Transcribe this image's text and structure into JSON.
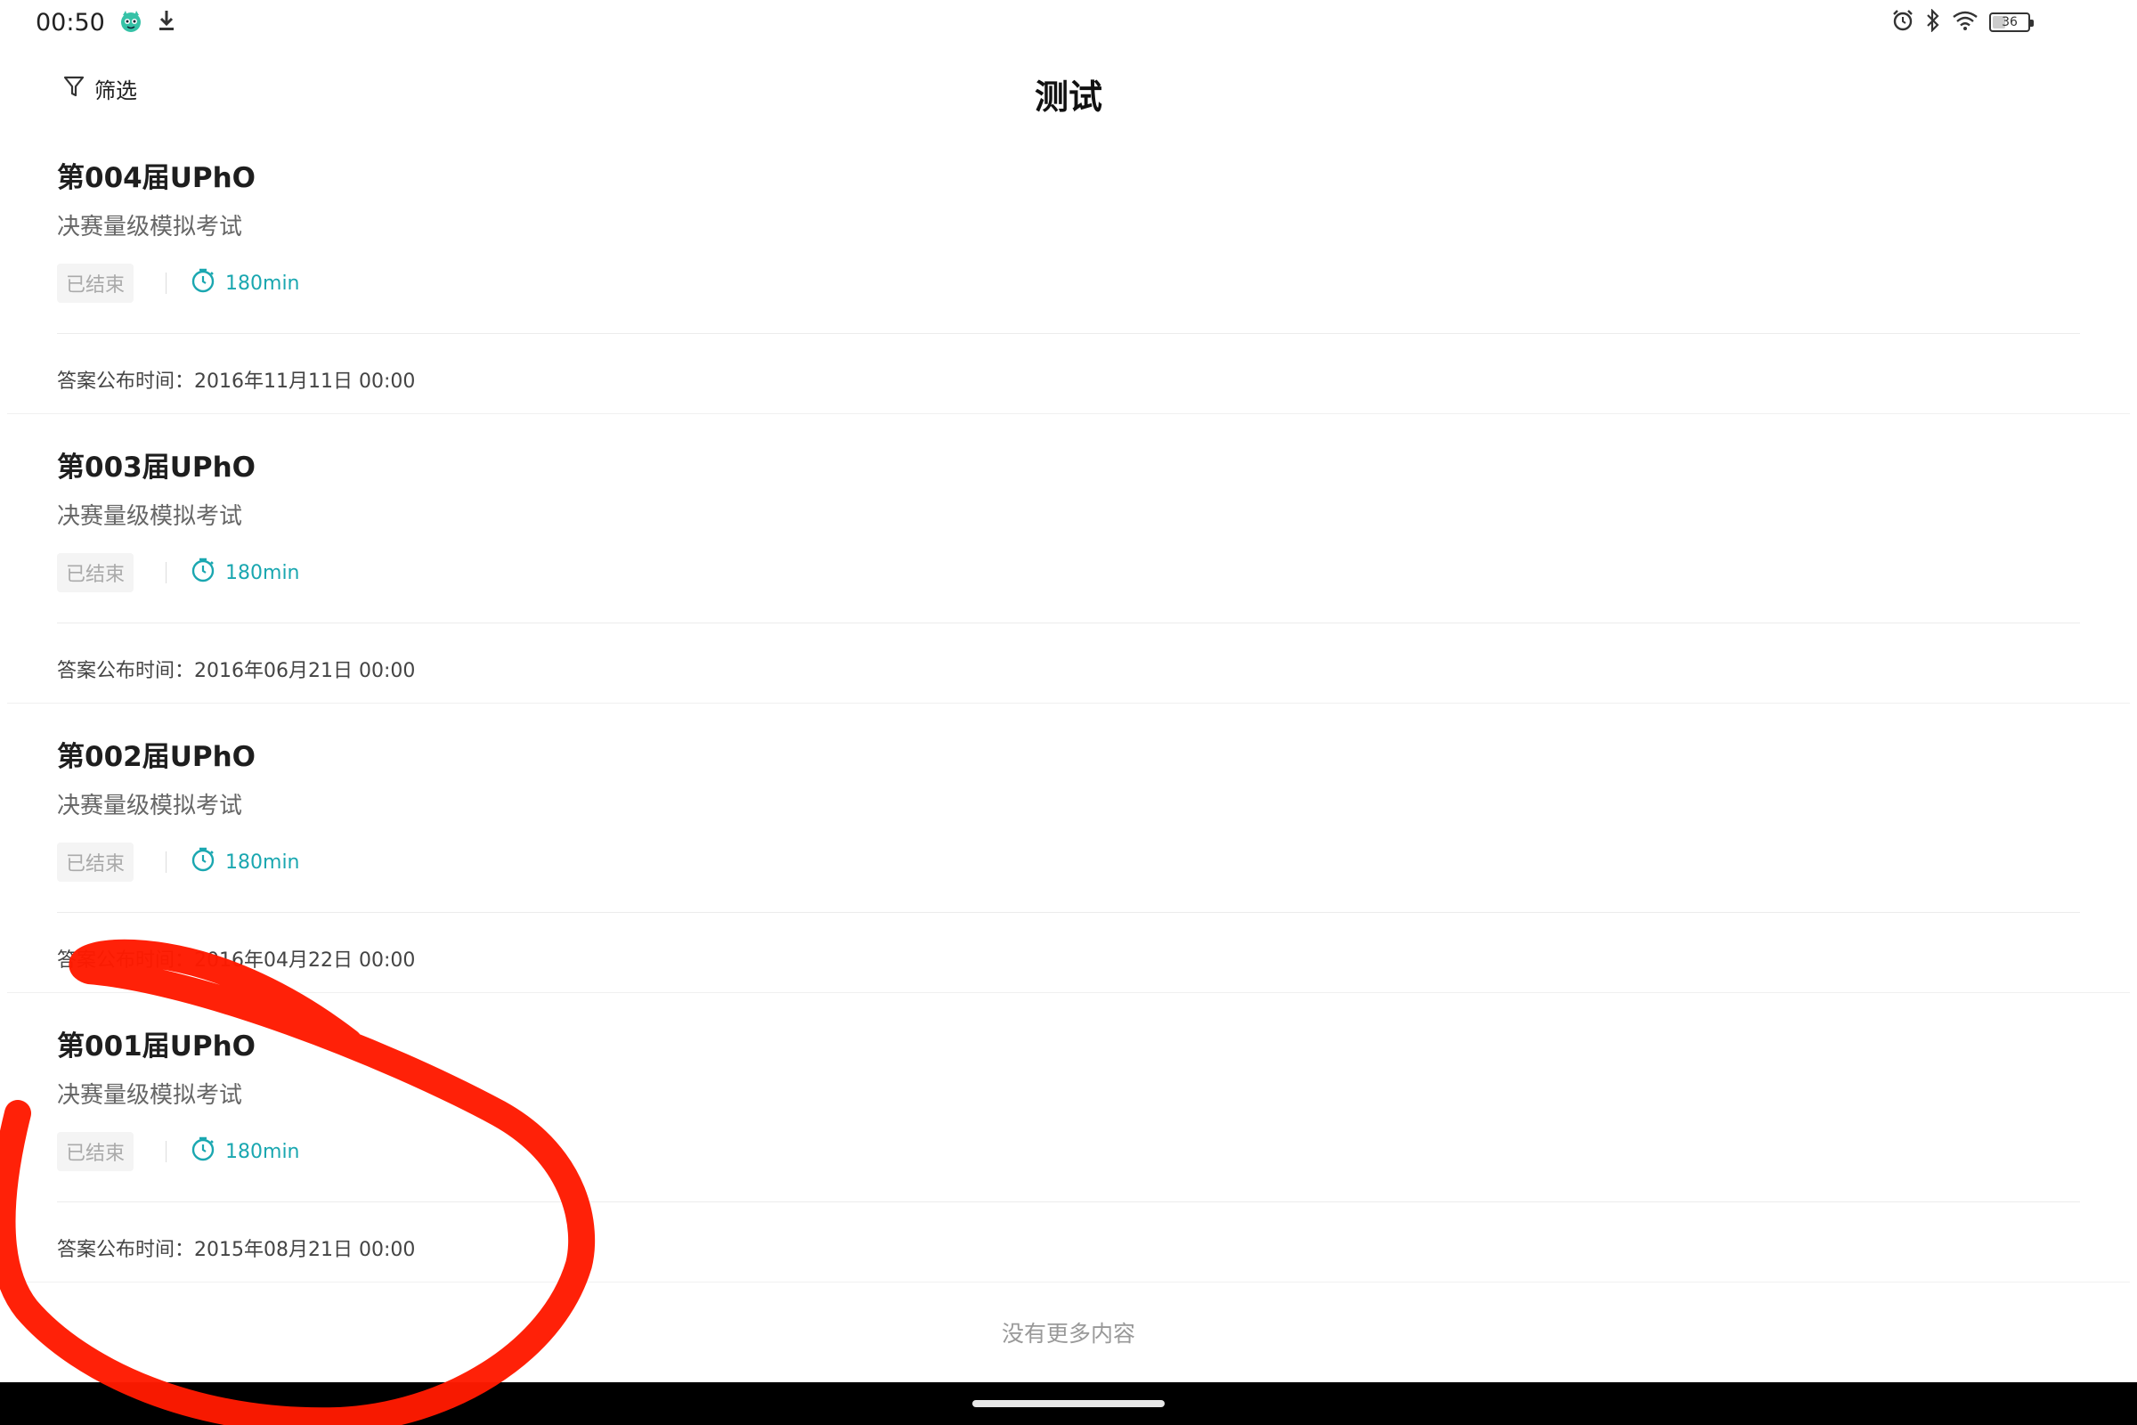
{
  "status_bar": {
    "time": "00:50",
    "battery_level": "36",
    "battery_fraction": 0.36,
    "icons": [
      "app-mascot-icon",
      "download-icon",
      "alarm-icon",
      "bluetooth-icon",
      "wifi-icon",
      "battery-icon"
    ]
  },
  "header": {
    "filter_label": "筛选",
    "title": "测试"
  },
  "colors": {
    "accent": "#1aa7b0",
    "tag_bg": "#f4f4f4",
    "annotation_red": "#ff1a00"
  },
  "exams": [
    {
      "title": "第004届UPhO",
      "subtitle": "决赛量级模拟考试",
      "status": "已结束",
      "duration": "180min",
      "answer_time": "答案公布时间：2016年11月11日 00:00"
    },
    {
      "title": "第003届UPhO",
      "subtitle": "决赛量级模拟考试",
      "status": "已结束",
      "duration": "180min",
      "answer_time": "答案公布时间：2016年06月21日 00:00"
    },
    {
      "title": "第002届UPhO",
      "subtitle": "决赛量级模拟考试",
      "status": "已结束",
      "duration": "180min",
      "answer_time": "答案公布时间：2016年04月22日 00:00"
    },
    {
      "title": "第001届UPhO",
      "subtitle": "决赛量级模拟考试",
      "status": "已结束",
      "duration": "180min",
      "answer_time": "答案公布时间：2015年08月21日 00:00"
    }
  ],
  "list_end_text": "没有更多内容"
}
